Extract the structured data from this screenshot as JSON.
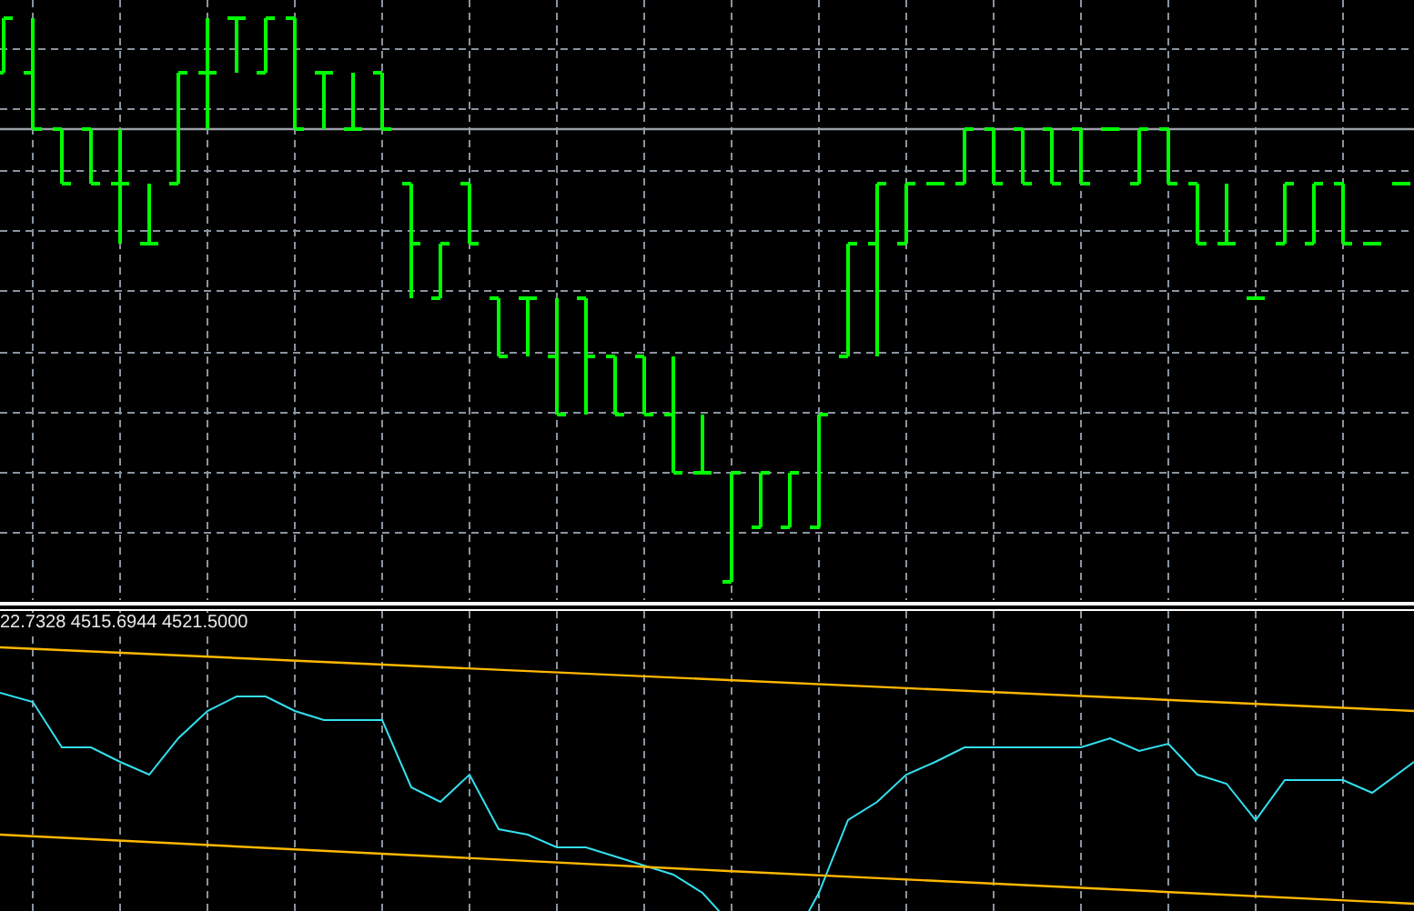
{
  "indicator_pane": {
    "readout": "22.7328 4515.6944 4521.5000"
  }
}
